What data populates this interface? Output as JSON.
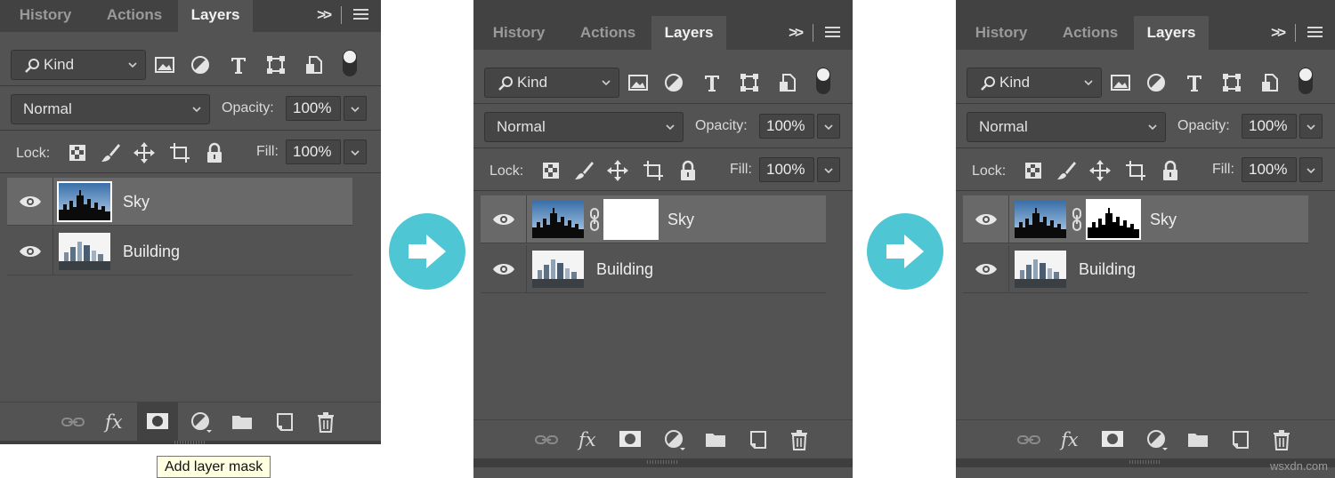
{
  "tabs": [
    "History",
    "Actions",
    "Layers"
  ],
  "tab_more": ">>",
  "kind_label": "Kind",
  "blend_mode": "Normal",
  "opacity_label": "Opacity:",
  "opacity_value": "100%",
  "lock_label": "Lock:",
  "fill_label": "Fill:",
  "fill_value": "100%",
  "panels": [
    {
      "layers": [
        {
          "name": "Sky",
          "selected": true,
          "mask": "none"
        },
        {
          "name": "Building",
          "selected": false,
          "mask": "none"
        }
      ]
    },
    {
      "layers": [
        {
          "name": "Sky",
          "selected": true,
          "mask": "white"
        },
        {
          "name": "Building",
          "selected": false,
          "mask": "none"
        }
      ]
    },
    {
      "layers": [
        {
          "name": "Sky",
          "selected": true,
          "mask": "skyline"
        },
        {
          "name": "Building",
          "selected": false,
          "mask": "none"
        }
      ]
    }
  ],
  "icons": {
    "filters": [
      "image-filter-icon",
      "adjustment-filter-icon",
      "type-filter-icon",
      "shape-filter-icon",
      "smart-object-filter-icon"
    ],
    "locks": [
      "lock-transparent-pixels-icon",
      "lock-image-pixels-icon",
      "lock-position-icon",
      "lock-artboard-icon",
      "lock-all-icon"
    ],
    "footer": [
      "link-layers-icon",
      "fx-icon",
      "add-layer-mask-icon",
      "adjustment-layer-icon",
      "group-folder-icon",
      "new-layer-icon",
      "delete-trash-icon"
    ]
  },
  "footer_fx": "fx",
  "tooltip": "Add layer mask",
  "watermark": "wsxdn.com",
  "colors": {
    "panel": "#535353",
    "tabbar": "#424242",
    "selected_row": "#696969",
    "arrow": "#4ec6d3"
  }
}
